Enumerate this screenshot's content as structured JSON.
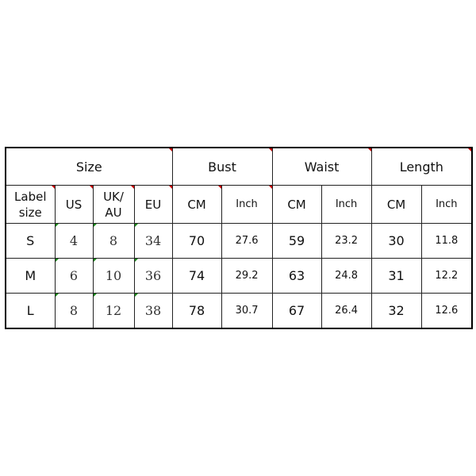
{
  "groups": {
    "size": "Size",
    "bust": "Bust",
    "waist": "Waist",
    "length": "Length"
  },
  "subheaders": {
    "label_size_1": "Label",
    "label_size_2": "size",
    "us": "US",
    "ukau_1": "UK/",
    "ukau_2": "AU",
    "eu": "EU",
    "bust_cm": "CM",
    "bust_inch": "Inch",
    "waist_cm": "CM",
    "waist_inch": "Inch",
    "length_cm": "CM",
    "length_inch": "Inch"
  },
  "rows": [
    {
      "label": "S",
      "us": "4",
      "ukau": "8",
      "eu": "34",
      "bust_cm": "70",
      "bust_inch": "27.6",
      "waist_cm": "59",
      "waist_inch": "23.2",
      "length_cm": "30",
      "length_inch": "11.8"
    },
    {
      "label": "M",
      "us": "6",
      "ukau": "10",
      "eu": "36",
      "bust_cm": "74",
      "bust_inch": "29.2",
      "waist_cm": "63",
      "waist_inch": "24.8",
      "length_cm": "31",
      "length_inch": "12.2"
    },
    {
      "label": "L",
      "us": "8",
      "ukau": "12",
      "eu": "38",
      "bust_cm": "78",
      "bust_inch": "30.7",
      "waist_cm": "67",
      "waist_inch": "26.4",
      "length_cm": "32",
      "length_inch": "12.6"
    }
  ]
}
